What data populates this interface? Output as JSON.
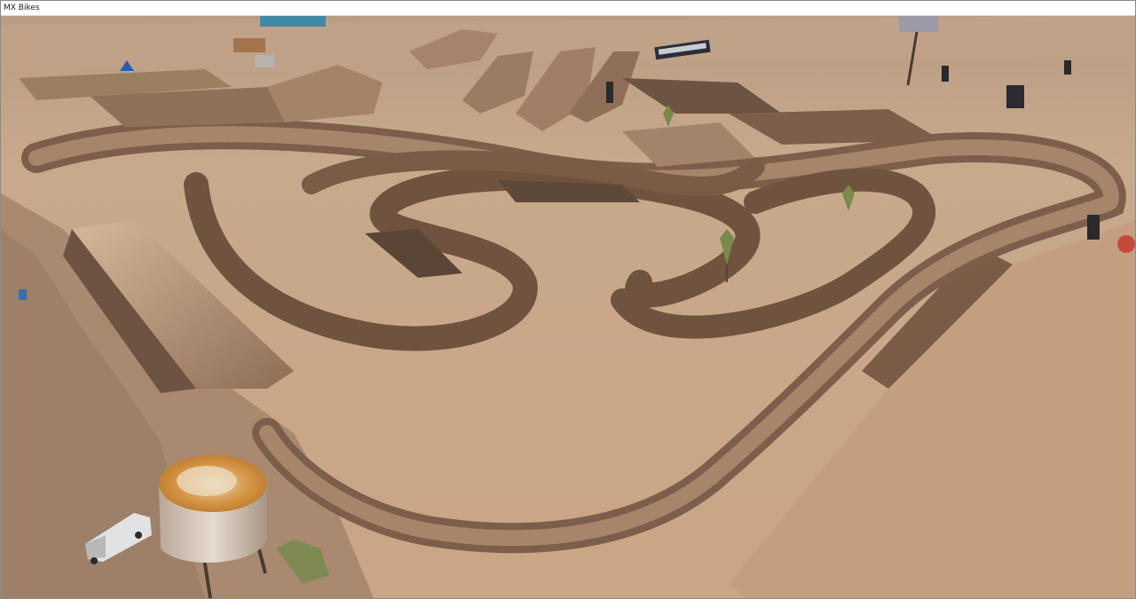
{
  "window": {
    "title": "MX Bikes"
  },
  "scene": {
    "description_colors": {
      "sand": "#c8a789",
      "sand_light": "#d8bda0",
      "sand_dark": "#8f6e55",
      "rut": "#6e5343",
      "shadow": "#5b4536",
      "tower_top": "#d98f3c",
      "tower_body": "#d8ccbf",
      "sky_band": "#b59a80"
    },
    "icons": [
      "water-tower",
      "truck",
      "banner",
      "billboard",
      "tree"
    ]
  }
}
